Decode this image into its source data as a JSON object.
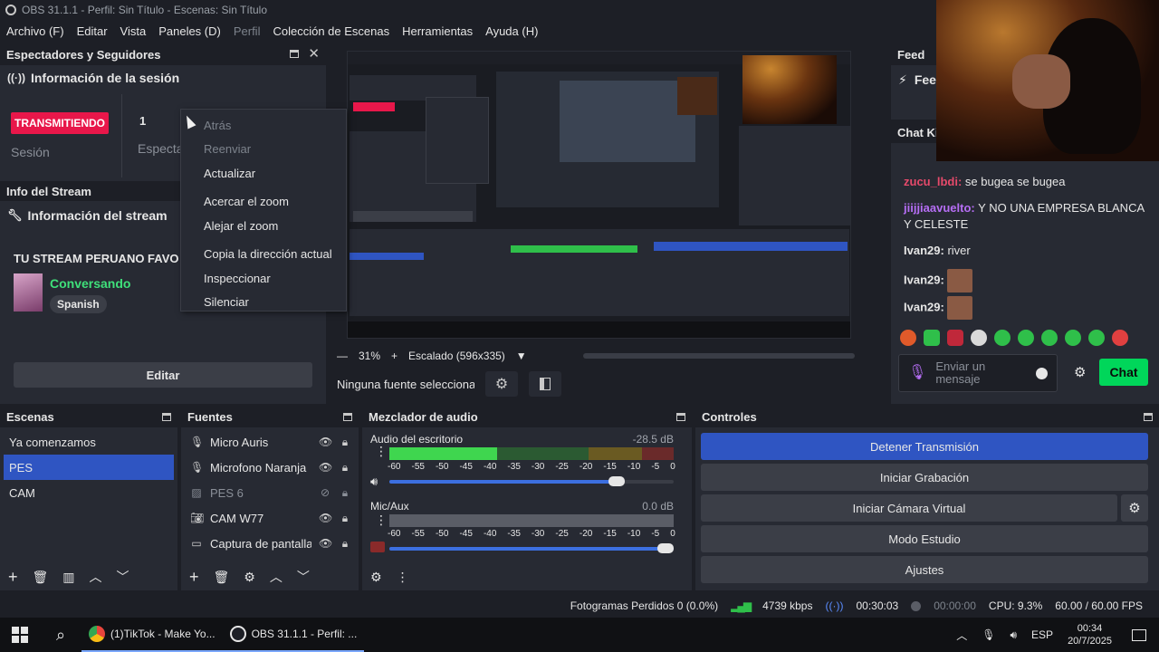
{
  "window": {
    "title": "OBS 31.1.1 - Perfil: Sin Título - Escenas: Sin Título"
  },
  "menu": [
    "Archivo (F)",
    "Editar",
    "Vista",
    "Paneles (D)",
    "Perfil",
    "Colección de Escenas",
    "Herramientas",
    "Ayuda (H)"
  ],
  "viewers": {
    "title": "Espectadores y Seguidores",
    "section": "Información de la sesión",
    "status": "TRANSMITIENDO",
    "count": "1",
    "session_label": "Sesión",
    "spectators_label": "Especta"
  },
  "stream_info": {
    "title": "Info del Stream",
    "section": "Información del stream",
    "stream_title": "TU STREAM PERUANO FAVO",
    "category": "Conversando",
    "language": "Spanish",
    "edit_button": "Editar"
  },
  "context_menu": {
    "items": [
      {
        "label": "Atrás",
        "enabled": false
      },
      {
        "label": "Reenviar",
        "enabled": false
      },
      {
        "label": "Actualizar",
        "enabled": true
      },
      {
        "label": "Acercar el zoom",
        "enabled": true
      },
      {
        "label": "Alejar el zoom",
        "enabled": true
      },
      {
        "label": "Copia la dirección actual",
        "enabled": true
      },
      {
        "label": "Inspeccionar",
        "enabled": true
      },
      {
        "label": "Silenciar",
        "enabled": true
      }
    ]
  },
  "preview": {
    "zoom": "31%",
    "scaling": "Escalado (596x335)",
    "no_source": "Ninguna fuente seleccionad"
  },
  "feed": {
    "title": "Feed",
    "section": "Fee"
  },
  "chat": {
    "title": "Chat Ki",
    "messages": [
      {
        "user": "zucu_lbdi:",
        "text": "se bugea se bugea",
        "color": "#e64a6b"
      },
      {
        "user": "jiijjiaavuelto:",
        "text": "Y NO UNA EMPRESA BLANCA Y CELESTE",
        "color": "#b66ef5"
      },
      {
        "user": "Ivan29:",
        "text": "river",
        "color": "#e6e6e6"
      },
      {
        "user": "Ivan29:",
        "text": "",
        "color": "#e6e6e6"
      },
      {
        "user": "Ivan29:",
        "text": "",
        "color": "#e6e6e6"
      }
    ],
    "input_placeholder": "Enviar un mensaje",
    "send_button": "Chat"
  },
  "scenes": {
    "title": "Escenas",
    "items": [
      "Ya comenzamos",
      "PES",
      "CAM"
    ],
    "selected": "PES"
  },
  "sources": {
    "title": "Fuentes",
    "items": [
      {
        "name": "Micro Auris",
        "icon": "mic-icon",
        "visible": true
      },
      {
        "name": "Microfono Naranja",
        "icon": "mic-icon",
        "visible": true
      },
      {
        "name": "PES 6",
        "icon": "image-icon",
        "visible": false
      },
      {
        "name": "CAM W77",
        "icon": "camera-icon",
        "visible": true
      },
      {
        "name": "Captura de pantalla",
        "icon": "monitor-icon",
        "visible": true
      }
    ]
  },
  "mixer": {
    "title": "Mezclador de audio",
    "channels": [
      {
        "name": "Audio del escritorio",
        "db": "-28.5 dB",
        "level": 0.38,
        "volume": 0.8
      },
      {
        "name": "Mic/Aux",
        "db": "0.0 dB",
        "level": 0.0,
        "volume": 1.0
      }
    ],
    "ticks": [
      "-60",
      "-55",
      "-50",
      "-45",
      "-40",
      "-35",
      "-30",
      "-25",
      "-20",
      "-15",
      "-10",
      "-5",
      "0"
    ]
  },
  "controls": {
    "title": "Controles",
    "stop_stream": "Detener Transmisión",
    "start_recording": "Iniciar Grabación",
    "start_vcam": "Iniciar Cámara Virtual",
    "studio_mode": "Modo Estudio",
    "settings": "Ajustes"
  },
  "status": {
    "dropped": "Fotogramas Perdidos 0 (0.0%)",
    "bitrate": "4739 kbps",
    "stream_time": "00:30:03",
    "rec_time": "00:00:00",
    "cpu": "CPU: 9.3%",
    "fps": "60.00 / 60.00 FPS"
  },
  "taskbar": {
    "tiktok": "(1)TikTok - Make Yo...",
    "obs": "OBS 31.1.1 - Perfil: ...",
    "lang": "ESP",
    "time": "00:34",
    "date": "20/7/2025"
  },
  "colors": {
    "accent": "#2f55c2",
    "live": "#e8174a",
    "chat_green": "#00d65a",
    "bg": "#1d1f26",
    "panel": "#272a33"
  }
}
